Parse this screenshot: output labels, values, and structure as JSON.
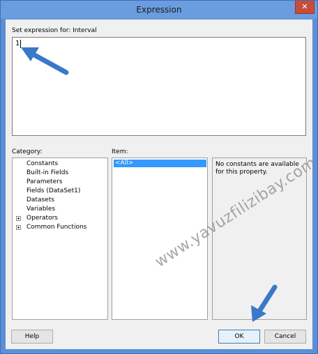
{
  "window": {
    "title": "Expression",
    "close_symbol": "✕"
  },
  "expression": {
    "label": "Set expression for: Interval",
    "value": "1"
  },
  "category": {
    "label": "Category:",
    "items": [
      "Constants",
      "Built-in Fields",
      "Parameters",
      "Fields (DataSet1)",
      "Datasets",
      "Variables",
      "Operators",
      "Common Functions"
    ]
  },
  "item": {
    "label": "Item:",
    "selected": "<All>"
  },
  "description": {
    "text": "No constants are available for this property."
  },
  "buttons": {
    "help": "Help",
    "ok": "OK",
    "cancel": "Cancel"
  },
  "watermark": {
    "text": "www.yavuzfilizibay.com"
  },
  "colors": {
    "arrow": "#3a78c8",
    "selection": "#3399ff",
    "titlebar": "#6a9de0",
    "close_button": "#c74c3c"
  }
}
